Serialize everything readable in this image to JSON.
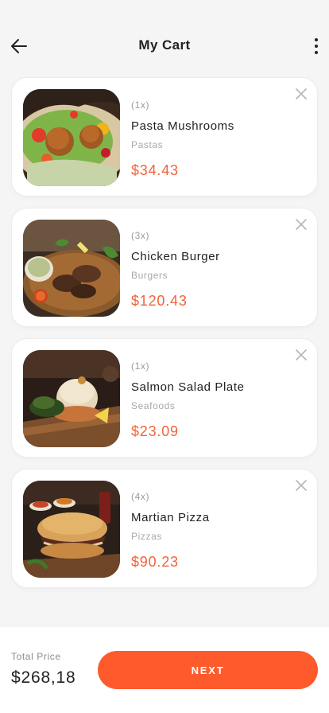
{
  "header": {
    "title": "My Cart",
    "back_icon": "arrow-left-icon",
    "menu_icon": "more-vertical-icon"
  },
  "cart": {
    "items": [
      {
        "qty": "(1x)",
        "name": "Pasta Mushrooms",
        "category": "Pastas",
        "price": "$34.43"
      },
      {
        "qty": "(3x)",
        "name": "Chicken Burger",
        "category": "Burgers",
        "price": "$120.43"
      },
      {
        "qty": "(1x)",
        "name": "Salmon Salad Plate",
        "category": "Seafoods",
        "price": "$23.09"
      },
      {
        "qty": "(4x)",
        "name": "Martian Pizza",
        "category": "Pizzas",
        "price": "$90.23"
      }
    ]
  },
  "footer": {
    "total_label": "Total Price",
    "total_value": "$268,18",
    "next_label": "NEXT"
  },
  "colors": {
    "accent": "#ff5a2c",
    "price": "#f0643a",
    "background": "#f5f5f5"
  }
}
